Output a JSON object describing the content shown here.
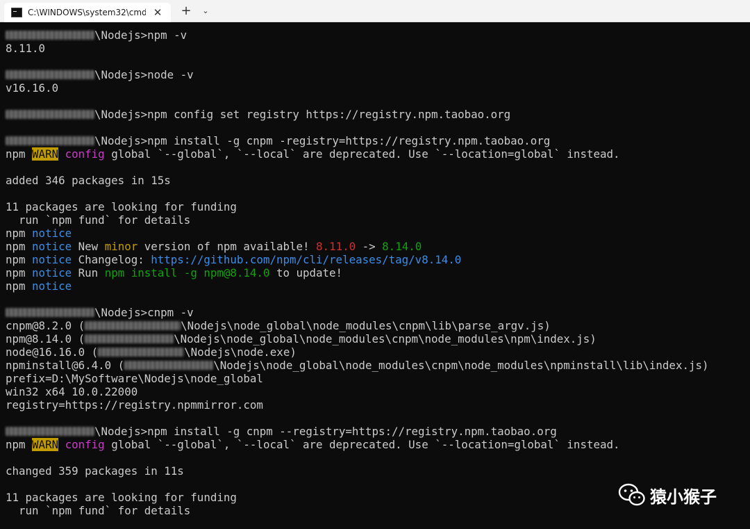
{
  "window": {
    "tab_title": "C:\\WINDOWS\\system32\\cmd.",
    "close_glyph": "✕",
    "new_tab_glyph": "+",
    "dropdown_glyph": "⌄"
  },
  "console": {
    "l1": "\\Nodejs>npm -v",
    "l2": "8.11.0",
    "l3": "\\Nodejs>node -v",
    "l4": "v16.16.0",
    "l5": "\\Nodejs>npm config set registry https://registry.npm.taobao.org",
    "l6": "\\Nodejs>npm install -g cnpm -registry=https://registry.npm.taobao.org",
    "warn_npm": "npm ",
    "warn_tag": "WARN",
    "warn_config": "config",
    "warn_msg": " global `--global`, `--local` are deprecated. Use `--location=global` instead.",
    "l8": "added 346 packages in 15s",
    "l9": "11 packages are looking for funding",
    "l10": "  run `npm fund` for details",
    "notice_npm": "npm ",
    "notice_tag": "notice",
    "n2_a": " New ",
    "n2_minor": "minor",
    "n2_b": " version of npm available! ",
    "n2_old": "8.11.0",
    "n2_arrow": " -> ",
    "n2_new": "8.14.0",
    "n3_a": " Changelog: ",
    "n3_link": "https://github.com/npm/cli/releases/tag/v8.14.0",
    "n4_a": " Run ",
    "n4_cmd": "npm install -g npm@8.14.0",
    "n4_b": " to update!",
    "l16": "\\Nodejs>cnpm -v",
    "l17a": "cnpm@8.2.0 (",
    "l17b": "\\Nodejs\\node_global\\node_modules\\cnpm\\lib\\parse_argv.js)",
    "l18a": "npm@8.14.0 (",
    "l18b": "\\Nodejs\\node_global\\node_modules\\cnpm\\node_modules\\npm\\index.js)",
    "l19a": "node@16.16.0 (",
    "l19b": "\\Nodejs\\node.exe)",
    "l20a": "npminstall@6.4.0 (",
    "l20b": "\\Nodejs\\node_global\\node_modules\\cnpm\\node_modules\\npminstall\\lib\\index.js)",
    "l21": "prefix=D:\\MySoftware\\Nodejs\\node_global",
    "l22": "win32 x64 10.0.22000",
    "l23": "registry=https://registry.npmmirror.com",
    "l24": "\\Nodejs>npm install -g cnpm --registry=https://registry.npm.taobao.org",
    "l26": "changed 359 packages in 11s",
    "l27": "11 packages are looking for funding",
    "l28": "  run `npm fund` for details"
  },
  "watermark": {
    "text": "猿小猴子"
  }
}
